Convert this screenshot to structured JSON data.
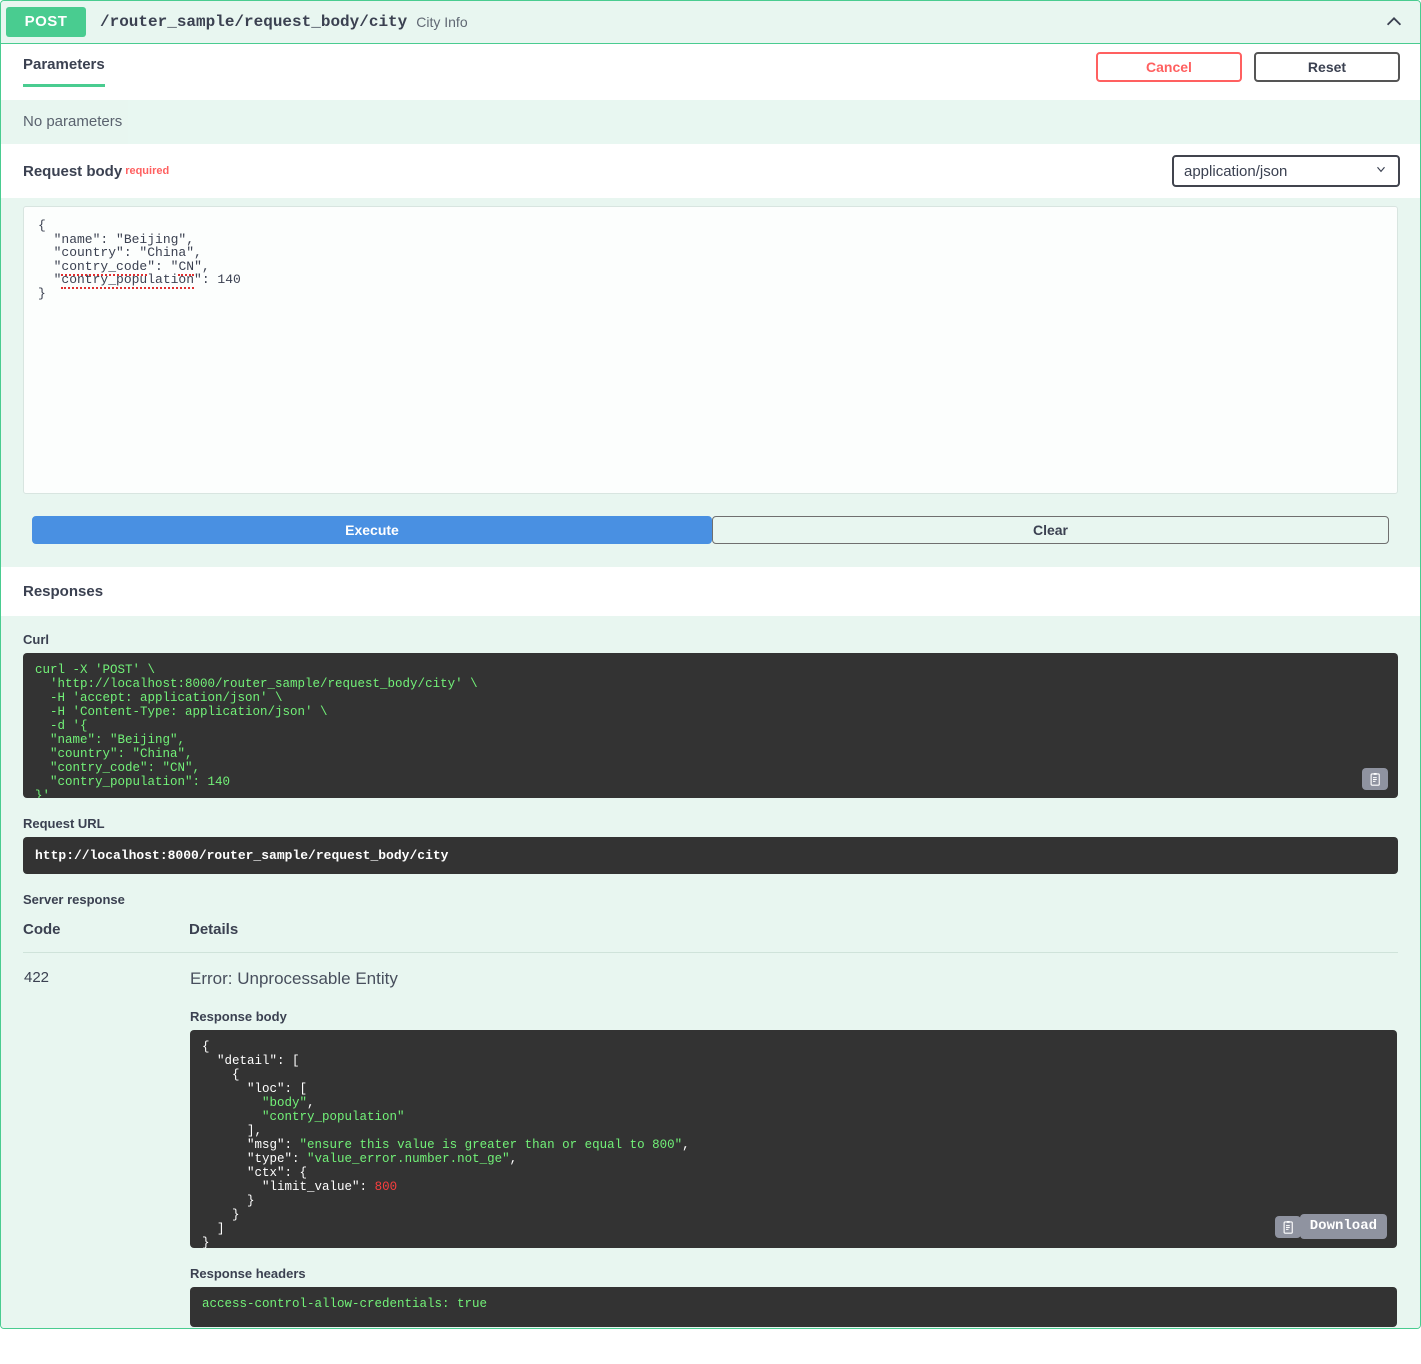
{
  "operation": {
    "method": "POST",
    "path": "/router_sample/request_body/city",
    "summary": "City Info",
    "collapse_icon": "chevron-up-icon",
    "accent_color": "#49cc90"
  },
  "tabs": {
    "parameters_label": "Parameters"
  },
  "header_buttons": {
    "cancel_label": "Cancel",
    "reset_label": "Reset",
    "cancel_color": "#ff6060",
    "reset_color": "#555555"
  },
  "parameters": {
    "empty_text": "No parameters"
  },
  "request_body": {
    "label": "Request body",
    "required_label": "required",
    "content_type_value": "application/json",
    "content_type_options": [
      "application/json"
    ],
    "caret_icon": "chevron-down-icon",
    "editor_lines": [
      "{",
      "  \"name\": \"Beijing\",",
      "  \"country\": \"China\",",
      "  \"contry_code\": \"CN\",",
      "  \"contry_population\": 140",
      "}"
    ],
    "editor_value": "{\n  \"name\": \"Beijing\",\n  \"country\": \"China\",\n  \"contry_code\": \"CN\",\n  \"contry_population\": 140\n}"
  },
  "actions": {
    "execute_label": "Execute",
    "execute_color": "#4990e2",
    "clear_label": "Clear"
  },
  "responses": {
    "section_title": "Responses",
    "curl_label": "Curl",
    "curl_command": "curl -X 'POST' \\\n  'http://localhost:8000/router_sample/request_body/city' \\\n  -H 'accept: application/json' \\\n  -H 'Content-Type: application/json' \\\n  -d '{\n  \"name\": \"Beijing\",\n  \"country\": \"China\",\n  \"contry_code\": \"CN\",\n  \"contry_population\": 140\n}'",
    "curl_copy_icon": "copy-clipboard-icon",
    "request_url_label": "Request URL",
    "request_url": "http://localhost:8000/router_sample/request_body/city",
    "server_response_label": "Server response",
    "table_headers": {
      "code": "Code",
      "details": "Details"
    },
    "rows": [
      {
        "code": "422",
        "error_title": "Error: Unprocessable Entity",
        "response_body_label": "Response body",
        "response_body": "{\n  \"detail\": [\n    {\n      \"loc\": [\n        \"body\",\n        \"contry_population\"\n      ],\n      \"msg\": \"ensure this value is greater than or equal to 800\",\n      \"type\": \"value_error.number.not_ge\",\n      \"ctx\": {\n        \"limit_value\": 800\n      }\n    }\n  ]\n}",
        "copy_icon": "copy-clipboard-icon",
        "download_label": "Download",
        "response_headers_label": "Response headers",
        "response_headers": "access-control-allow-credentials: true"
      }
    ]
  },
  "syntax_colors": {
    "string": "#72f178",
    "key": "#ffffff",
    "number": "#f93e3e",
    "code_background": "#333333"
  }
}
